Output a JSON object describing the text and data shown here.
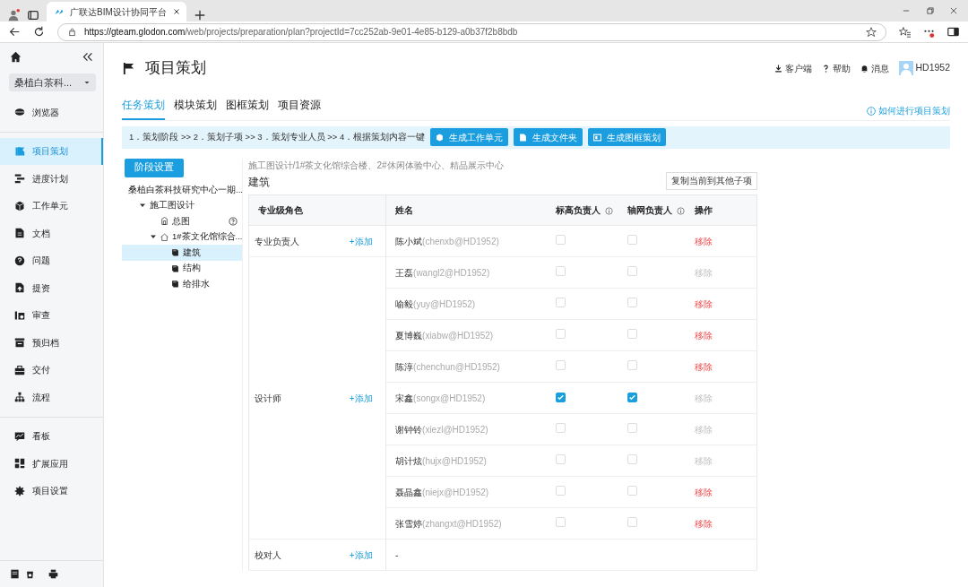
{
  "browser": {
    "tab_title": "广联达BIM设计协同平台",
    "url_host": "https://gteam.glodon.com",
    "url_path": "/web/projects/preparation/plan?projectId=7cc252ab-9e01-4e85-b129-a0b37f2b8bdb"
  },
  "sidebar": {
    "project_select": "桑植白茶科...",
    "groups": [
      {
        "items": [
          {
            "label": "浏览器",
            "selected": false
          }
        ]
      },
      {
        "items": [
          {
            "label": "项目策划",
            "selected": true
          },
          {
            "label": "进度计划",
            "selected": false
          },
          {
            "label": "工作单元",
            "selected": false
          },
          {
            "label": "文档",
            "selected": false
          },
          {
            "label": "问题",
            "selected": false
          },
          {
            "label": "提资",
            "selected": false
          },
          {
            "label": "审查",
            "selected": false
          },
          {
            "label": "预归档",
            "selected": false
          },
          {
            "label": "交付",
            "selected": false
          },
          {
            "label": "流程",
            "selected": false
          }
        ]
      },
      {
        "items": [
          {
            "label": "看板",
            "selected": false
          },
          {
            "label": "扩展应用",
            "selected": false
          },
          {
            "label": "项目设置",
            "selected": false
          }
        ]
      }
    ]
  },
  "header": {
    "title": "项目策划",
    "links": [
      "客户端",
      "帮助",
      "消息"
    ],
    "user": "HD1952"
  },
  "tabs": [
    {
      "label": "任务策划",
      "selected": true
    },
    {
      "label": "模块策划",
      "selected": false
    },
    {
      "label": "图框策划",
      "selected": false
    },
    {
      "label": "项目资源",
      "selected": false
    }
  ],
  "help_link": "如何进行项目策划",
  "steps": {
    "text": "1．策划阶段 >> 2．策划子项 >> 3．策划专业人员 >> 4．根据策划内容一键",
    "buttons": [
      "生成工作单元",
      "生成文件夹",
      "生成图框策划"
    ]
  },
  "stage_button": "阶段设置",
  "tree": [
    {
      "label": "桑植白茶科技研究中心一期...",
      "children": [
        {
          "label": "施工图设计",
          "expanded": true,
          "children": [
            {
              "label": "总图",
              "kind": "general",
              "selected": false
            },
            {
              "label": "1#茶文化馆综合...",
              "kind": "building",
              "expanded": true,
              "children": [
                {
                  "label": "建筑",
                  "kind": "discipline",
                  "selected": true
                },
                {
                  "label": "结构",
                  "kind": "discipline",
                  "selected": false
                },
                {
                  "label": "给排水",
                  "kind": "discipline",
                  "selected": false
                }
              ]
            }
          ]
        }
      ]
    }
  ],
  "breadcrumb": "施工图设计/1#茶文化馆综合楼、2#休闲体验中心、精品展示中心",
  "section_title": "建筑",
  "copy_button": "复制当前到其他子项",
  "table": {
    "columns": [
      {
        "label": "专业级角色",
        "info": false
      },
      {
        "label": "姓名",
        "info": false
      },
      {
        "label": "标高负责人",
        "info": true
      },
      {
        "label": "轴网负责人",
        "info": true
      },
      {
        "label": "操作",
        "info": false
      }
    ],
    "groups": [
      {
        "role": "专业负责人",
        "add": "+添加",
        "members": [
          {
            "name": "陈小斌",
            "account": "(chenxb@HD1952)",
            "elevation": false,
            "grid": false,
            "remove": "移除",
            "disabled": false
          }
        ]
      },
      {
        "role": "设计师",
        "add": "+添加",
        "members": [
          {
            "name": "王磊",
            "account": "(wangl2@HD1952)",
            "elevation": false,
            "grid": false,
            "remove": "移除",
            "disabled": true
          },
          {
            "name": "喻毅",
            "account": "(yuy@HD1952)",
            "elevation": false,
            "grid": false,
            "remove": "移除",
            "disabled": false
          },
          {
            "name": "夏博巍",
            "account": "(xiabw@HD1952)",
            "elevation": false,
            "grid": false,
            "remove": "移除",
            "disabled": false
          },
          {
            "name": "陈淳",
            "account": "(chenchun@HD1952)",
            "elevation": false,
            "grid": false,
            "remove": "移除",
            "disabled": false
          },
          {
            "name": "宋鑫",
            "account": "(songx@HD1952)",
            "elevation": true,
            "grid": true,
            "remove": "移除",
            "disabled": true
          },
          {
            "name": "谢钟铃",
            "account": "(xiezl@HD1952)",
            "elevation": false,
            "grid": false,
            "remove": "移除",
            "disabled": true
          },
          {
            "name": "胡计炫",
            "account": "(hujx@HD1952)",
            "elevation": false,
            "grid": false,
            "remove": "移除",
            "disabled": true
          },
          {
            "name": "聂晶鑫",
            "account": "(niejx@HD1952)",
            "elevation": false,
            "grid": false,
            "remove": "移除",
            "disabled": false
          },
          {
            "name": "张雪婷",
            "account": "(zhangxt@HD1952)",
            "elevation": false,
            "grid": false,
            "remove": "移除",
            "disabled": false
          }
        ]
      },
      {
        "role": "校对人",
        "add": "+添加",
        "empty_text": "-"
      }
    ]
  }
}
